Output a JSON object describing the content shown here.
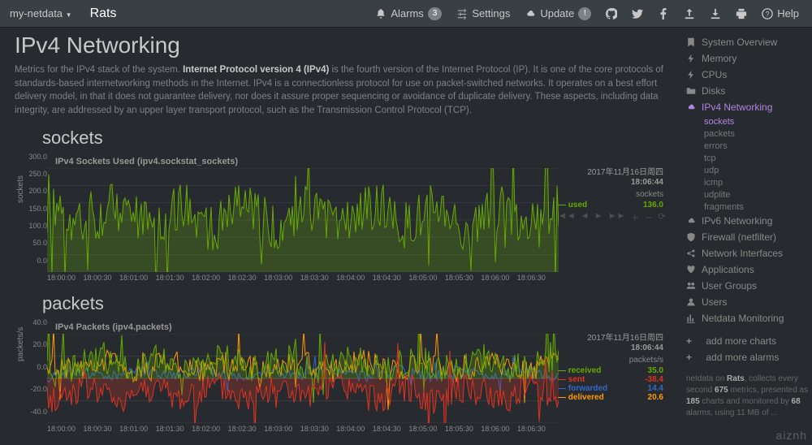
{
  "nav": {
    "brand": "my-netdata",
    "host": "Rats",
    "alarms_label": "Alarms",
    "alarms_count": "3",
    "settings": "Settings",
    "update_label": "Update",
    "update_badge": "!",
    "help": "Help"
  },
  "page": {
    "title": "IPv4 Networking",
    "desc_pre": "Metrics for the IPv4 stack of the system. ",
    "desc_bold": "Internet Protocol version 4 (IPv4)",
    "desc_post": " is the fourth version of the Internet Protocol (IP). It is one of the core protocols of standards-based internetworking methods in the Internet. IPv4 is a connectionless protocol for use on packet-switched networks. It operates on a best effort delivery model, in that it does not guarantee delivery, nor does it assure proper sequencing or avoidance of duplicate delivery. These aspects, including data integrity, are addressed by an upper layer transport protocol, such as the Transmission Control Protocol (TCP)."
  },
  "sections": {
    "sockets": "sockets",
    "packets": "packets"
  },
  "chart1": {
    "title": "IPv4 Sockets Used (ipv4.sockstat_sockets)",
    "ylabel": "sockets",
    "date": "2017年11月16日周四",
    "time": "18:06:44",
    "unit": "sockets",
    "legend": [
      {
        "name": "used",
        "value": "136.0",
        "color": "#66aa00"
      }
    ],
    "yticks": [
      "300.0",
      "250.0",
      "200.0",
      "150.0",
      "100.0",
      "50.0",
      "0.0"
    ],
    "xticks": [
      "18:00:00",
      "18:00:30",
      "18:01:00",
      "18:01:30",
      "18:02:00",
      "18:02:30",
      "18:03:00",
      "18:03:30",
      "18:04:00",
      "18:04:30",
      "18:05:00",
      "18:05:30",
      "18:06:00",
      "18:06:30"
    ]
  },
  "chart2": {
    "title": "IPv4 Packets (ipv4.packets)",
    "ylabel": "packets/s",
    "date": "2017年11月16日周四",
    "time": "18:06:44",
    "unit": "packets/s",
    "legend": [
      {
        "name": "received",
        "value": "35.0",
        "color": "#66aa00"
      },
      {
        "name": "sent",
        "value": "-38.4",
        "color": "#dd3322"
      },
      {
        "name": "forwarded",
        "value": "14.4",
        "color": "#3366cc"
      },
      {
        "name": "delivered",
        "value": "20.6",
        "color": "#ff9900"
      }
    ],
    "yticks": [
      "40.0",
      "20.0",
      "0.0",
      "-20.0",
      "-40.0"
    ],
    "xticks": [
      "18:00:00",
      "18:00:30",
      "18:01:00",
      "18:01:30",
      "18:02:00",
      "18:02:30",
      "18:03:00",
      "18:03:30",
      "18:04:00",
      "18:04:30",
      "18:05:00",
      "18:05:30",
      "18:06:00",
      "18:06:30"
    ]
  },
  "sidebar": {
    "items": [
      {
        "label": "System Overview",
        "icon": "bookmark"
      },
      {
        "label": "Memory",
        "icon": "bolt"
      },
      {
        "label": "CPUs",
        "icon": "bolt"
      },
      {
        "label": "Disks",
        "icon": "folder"
      },
      {
        "label": "IPv4 Networking",
        "icon": "cloud",
        "active": true,
        "subs": [
          {
            "label": "sockets",
            "active": true
          },
          {
            "label": "packets"
          },
          {
            "label": "errors"
          },
          {
            "label": "tcp"
          },
          {
            "label": "udp"
          },
          {
            "label": "icmp"
          },
          {
            "label": "udplite"
          },
          {
            "label": "fragments"
          }
        ]
      },
      {
        "label": "IPv6 Networking",
        "icon": "cloud"
      },
      {
        "label": "Firewall (netfilter)",
        "icon": "shield"
      },
      {
        "label": "Network Interfaces",
        "icon": "share"
      },
      {
        "label": "Applications",
        "icon": "heart"
      },
      {
        "label": "User Groups",
        "icon": "users"
      },
      {
        "label": "Users",
        "icon": "user"
      },
      {
        "label": "Netdata Monitoring",
        "icon": "barchart"
      }
    ],
    "more_charts": "add more charts",
    "more_alarms": "add more alarms",
    "foot_pre": "netdata on ",
    "foot_host": "Rats",
    "foot_a": ", collects every second ",
    "foot_m": "675",
    "foot_b": " metrics, presented as ",
    "foot_c": "185",
    "foot_d": " charts and monitored by ",
    "foot_al": "68",
    "foot_e": " alarms, using 11 MB of ..."
  },
  "watermark": "aiznh",
  "chart_data": [
    {
      "type": "line",
      "title": "IPv4 Sockets Used (ipv4.sockstat_sockets)",
      "xlabel": "time",
      "ylabel": "sockets",
      "ylim": [
        0,
        300
      ],
      "x_range": [
        "18:00:00",
        "18:06:44"
      ],
      "series": [
        {
          "name": "used",
          "color": "#66aa00",
          "approx_mean": 160,
          "approx_min": 50,
          "approx_max": 300,
          "last": 136.0,
          "note": "dense spiky per-second data; values bounce roughly 60–300"
        }
      ]
    },
    {
      "type": "line",
      "title": "IPv4 Packets (ipv4.packets)",
      "xlabel": "time",
      "ylabel": "packets/s",
      "ylim": [
        -45,
        45
      ],
      "x_range": [
        "18:00:00",
        "18:06:44"
      ],
      "series": [
        {
          "name": "received",
          "color": "#66aa00",
          "last": 35.0,
          "approx_range": [
            0,
            45
          ]
        },
        {
          "name": "sent",
          "color": "#dd3322",
          "last": -38.4,
          "approx_range": [
            -45,
            0
          ]
        },
        {
          "name": "forwarded",
          "color": "#3366cc",
          "last": 14.4,
          "approx_range": [
            0,
            15
          ]
        },
        {
          "name": "delivered",
          "color": "#ff9900",
          "last": 20.6,
          "approx_range": [
            -5,
            30
          ]
        }
      ]
    }
  ]
}
